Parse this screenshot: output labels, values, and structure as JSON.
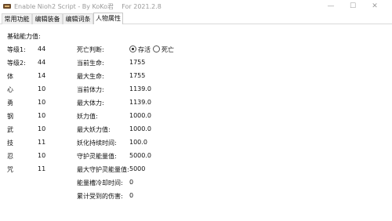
{
  "window": {
    "title": "Enable Nioh2 Script - By KoKo君    For 2021.2.8",
    "min_glyph": "—",
    "max_glyph": "☐",
    "close_glyph": "✕"
  },
  "tabs": [
    {
      "label": "常用功能"
    },
    {
      "label": "编辑装备"
    },
    {
      "label": "编辑词条"
    },
    {
      "label": "人物属性"
    }
  ],
  "basic": {
    "heading": "基础能力值:",
    "stats": [
      {
        "label": "等级1:",
        "value": "44"
      },
      {
        "label": "等级2:",
        "value": "44"
      },
      {
        "label": "体",
        "value": "14"
      },
      {
        "label": "心",
        "value": "10"
      },
      {
        "label": "勇",
        "value": "10"
      },
      {
        "label": "钢",
        "value": "10"
      },
      {
        "label": "武",
        "value": "10"
      },
      {
        "label": "技",
        "value": "11"
      },
      {
        "label": "忍",
        "value": "10"
      },
      {
        "label": "咒",
        "value": "11"
      }
    ]
  },
  "status": {
    "death_label": "死亡判断:",
    "alive_label": "存活",
    "dead_label": "死亡",
    "selected": "alive",
    "rows": [
      {
        "label": "当前生命:",
        "value": "1755"
      },
      {
        "label": "最大生命:",
        "value": "1755"
      },
      {
        "label": "当前体力:",
        "value": "1139.0"
      },
      {
        "label": "最大体力:",
        "value": "1139.0"
      },
      {
        "label": "妖力值:",
        "value": "1000.0"
      },
      {
        "label": "最大妖力值:",
        "value": "1000.0"
      },
      {
        "label": "妖化持续时间:",
        "value": "100.0"
      },
      {
        "label": "守护灵能量值:",
        "value": "5000.0"
      },
      {
        "label": "最大守护灵能量值:",
        "value": "5000"
      },
      {
        "label": "能量槽冷却时间:",
        "value": "0"
      },
      {
        "label": "累计受到的伤害:",
        "value": "0"
      }
    ]
  }
}
